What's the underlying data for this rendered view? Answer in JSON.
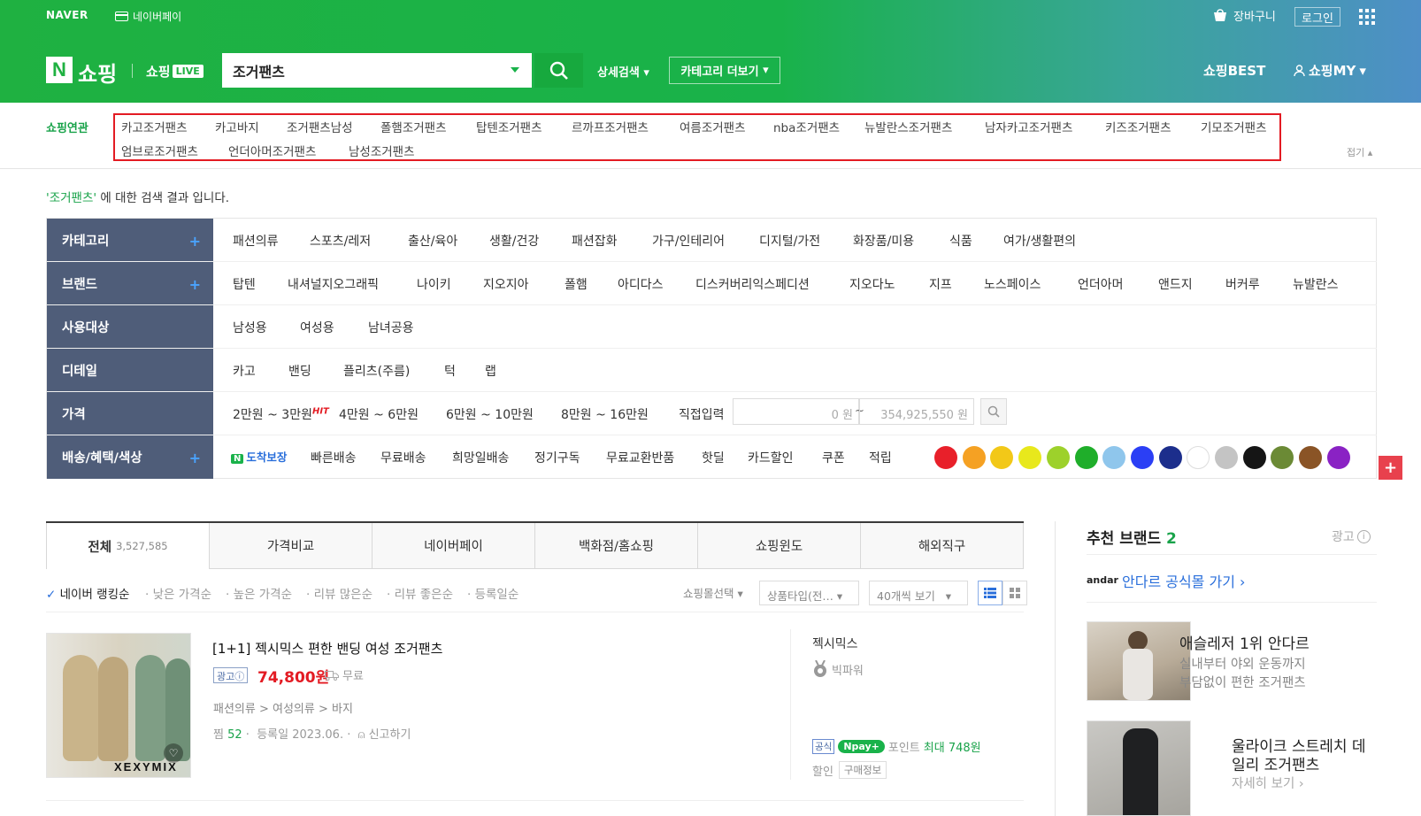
{
  "header": {
    "naver": "NAVER",
    "naver_pay": "네이버페이",
    "cart": "장바구니",
    "login": "로그인",
    "brand_n": "N",
    "brand_shopping": "쇼핑",
    "brand_live_prefix": "쇼핑",
    "brand_live_badge": "LIVE",
    "search_value": "조거팬츠",
    "detail_search": "상세검색",
    "category_more": "카테고리 더보기",
    "best": "쇼핑BEST",
    "my": "쇼핑MY"
  },
  "related": {
    "label": "쇼핑연관",
    "items": [
      "카고조거팬츠",
      "카고바지",
      "조거팬츠남성",
      "폴햄조거팬츠",
      "탑텐조거팬츠",
      "르까프조거팬츠",
      "여름조거팬츠",
      "nba조거팬츠",
      "뉴발란스조거팬츠",
      "남자카고조거팬츠",
      "키즈조거팬츠",
      "기모조거팬츠",
      "엄브로조거팬츠",
      "언더아머조거팬츠",
      "남성조거팬츠"
    ],
    "fold": "접기"
  },
  "result": {
    "keyword": "'조거팬츠'",
    "suffix": " 에 대한 검색 결과 입니다."
  },
  "filters": {
    "category": {
      "label": "카테고리",
      "items": [
        "패션의류",
        "스포츠/레저",
        "출산/육아",
        "생활/건강",
        "패션잡화",
        "가구/인테리어",
        "디지털/가전",
        "화장품/미용",
        "식품",
        "여가/생활편의"
      ]
    },
    "brand": {
      "label": "브랜드",
      "items": [
        "탑텐",
        "내셔널지오그래픽",
        "나이키",
        "지오지아",
        "폴햄",
        "아디다스",
        "디스커버리익스페디션",
        "지오다노",
        "지프",
        "노스페이스",
        "언더아머",
        "앤드지",
        "버커루",
        "뉴발란스"
      ]
    },
    "target": {
      "label": "사용대상",
      "items": [
        "남성용",
        "여성용",
        "남녀공용"
      ]
    },
    "detail": {
      "label": "디테일",
      "items": [
        "카고",
        "밴딩",
        "플리츠(주름)",
        "턱",
        "랩"
      ]
    },
    "price": {
      "label": "가격",
      "ranges": [
        "2만원 ~ 3만원",
        "4만원 ~ 6만원",
        "6만원 ~ 10만원",
        "8만원 ~ 16만원"
      ],
      "hit": "HIT",
      "direct": "직접입력",
      "min": "0 원",
      "tilde": "~",
      "max": "354,925,550 원"
    },
    "delivery": {
      "label": "배송/혜택/색상",
      "badge": "도착보장",
      "items": [
        "빠른배송",
        "무료배송",
        "희망일배송",
        "정기구독",
        "무료교환반품",
        "핫딜",
        "카드할인",
        "쿠폰",
        "적립"
      ],
      "colors": [
        "#e8202a",
        "#f5a123",
        "#f2c818",
        "#e8e81c",
        "#9dd12b",
        "#1fae2a",
        "#8fc6ec",
        "#2b3ff5",
        "#1c2e8c",
        "#ffffff",
        "#c4c4c4",
        "#151515",
        "#6b8a35",
        "#8a5426",
        "#8a22c4"
      ]
    }
  },
  "tabs": [
    {
      "label": "전체",
      "count": "3,527,585"
    },
    {
      "label": "가격비교"
    },
    {
      "label": "네이버페이"
    },
    {
      "label": "백화점/홈쇼핑"
    },
    {
      "label": "쇼핑윈도"
    },
    {
      "label": "해외직구"
    }
  ],
  "sort": {
    "items": [
      "네이버 랭킹순",
      "낮은 가격순",
      "높은 가격순",
      "리뷰 많은순",
      "리뷰 좋은순",
      "등록일순"
    ],
    "mall_select": "쇼핑몰선택",
    "product_type": "상품타입(전…",
    "page_size": "40개씩 보기"
  },
  "product": {
    "title": "[1+1] 젝시믹스 편한 밴딩 여성 조거팬츠",
    "ad": "광고ⓘ",
    "price": "74,800원",
    "shipping": "무료",
    "category_path": "패션의류 > 여성의류 > 바지",
    "zzim_label": "찜",
    "zzim_count": "52",
    "registered": "등록일 2023.06.",
    "report": "신고하기",
    "watermark": "XEXYMIX",
    "mall": "젝시믹스",
    "grade": "빅파워",
    "official": "공식",
    "npay": "Npay+",
    "point_prefix": "포인트",
    "point_max": "최대 748원",
    "discount": "할인",
    "purchase_info": "구매정보"
  },
  "sidebar": {
    "title": "추천 브랜드",
    "count": "2",
    "ad": "광고",
    "andar_logo": "andar",
    "andar_link": "안다르 공식몰 가기 ›",
    "card1_title": "애슬레저 1위 안다르",
    "card1_line1": "실내부터 야외 운동까지",
    "card1_line2": "부담없이 편한 조거팬츠",
    "card2_line1": "울라이크 스트레치 데",
    "card2_line2": "일리 조거팬츠",
    "card2_more": "자세히 보기 ›"
  }
}
